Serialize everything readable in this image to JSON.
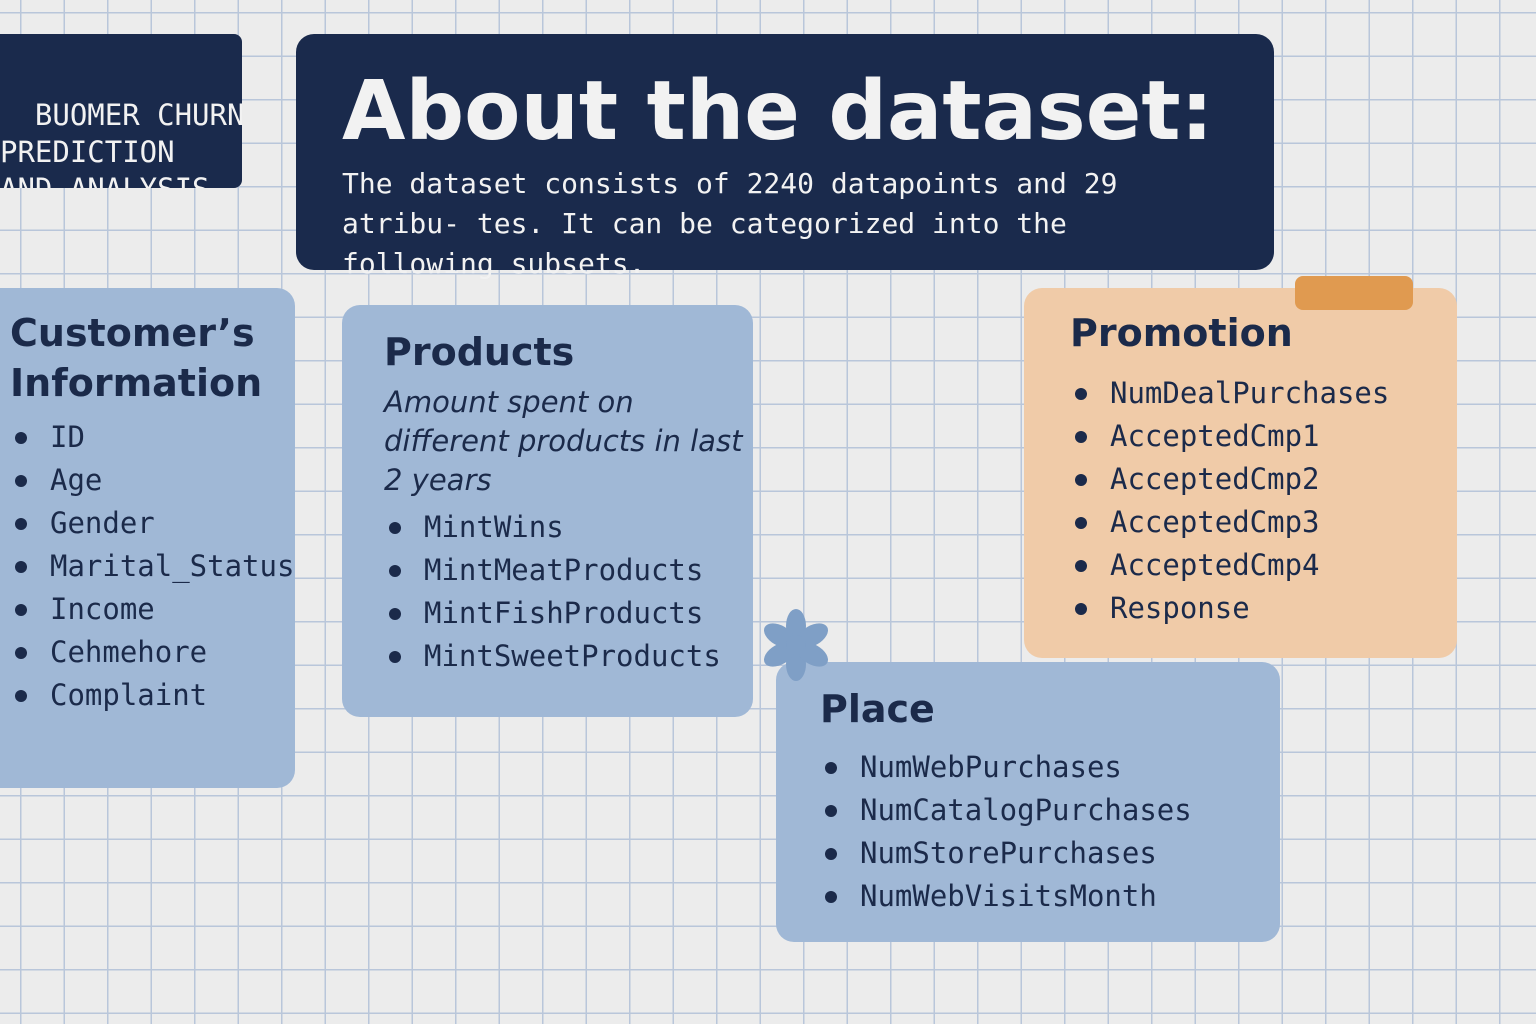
{
  "title_card": {
    "text": "BUOMER CHURN\nPREDICTION\nAND ANALYSIS"
  },
  "about": {
    "title": "About the dataset:",
    "description": "The dataset consists of 2240 datapoints and 29 atribu- tes. It can be categorized into the following subsets."
  },
  "customer": {
    "title": "Customer’s Information",
    "items": [
      "ID",
      "Age",
      "Gender",
      "Marital_Status",
      "Income",
      "Cehmehore",
      "Complaint"
    ]
  },
  "products": {
    "title": "Products",
    "description": "Amount spent on different products in last 2 years",
    "items": [
      "MintWins",
      "MintMeatProducts",
      "MintFishProducts",
      "MintSweetProducts"
    ]
  },
  "promotion": {
    "title": "Promotion",
    "items": [
      "NumDealPurchases",
      "AcceptedCmp1",
      "AcceptedCmp2",
      "AcceptedCmp3",
      "AcceptedCmp4",
      "Response"
    ]
  },
  "place": {
    "title": "Place",
    "items": [
      "NumWebPurchases",
      "NumCatalogPurchases",
      "NumStorePurchases",
      "NumWebVisitsMonth"
    ]
  },
  "colors": {
    "dark_navy": "#1a2a4c",
    "card_blue": "#a0b8d6",
    "card_orange": "#f0cba8",
    "tab_orange": "#e09a50",
    "grid_line": "#b9c6da",
    "background": "#ececec"
  }
}
